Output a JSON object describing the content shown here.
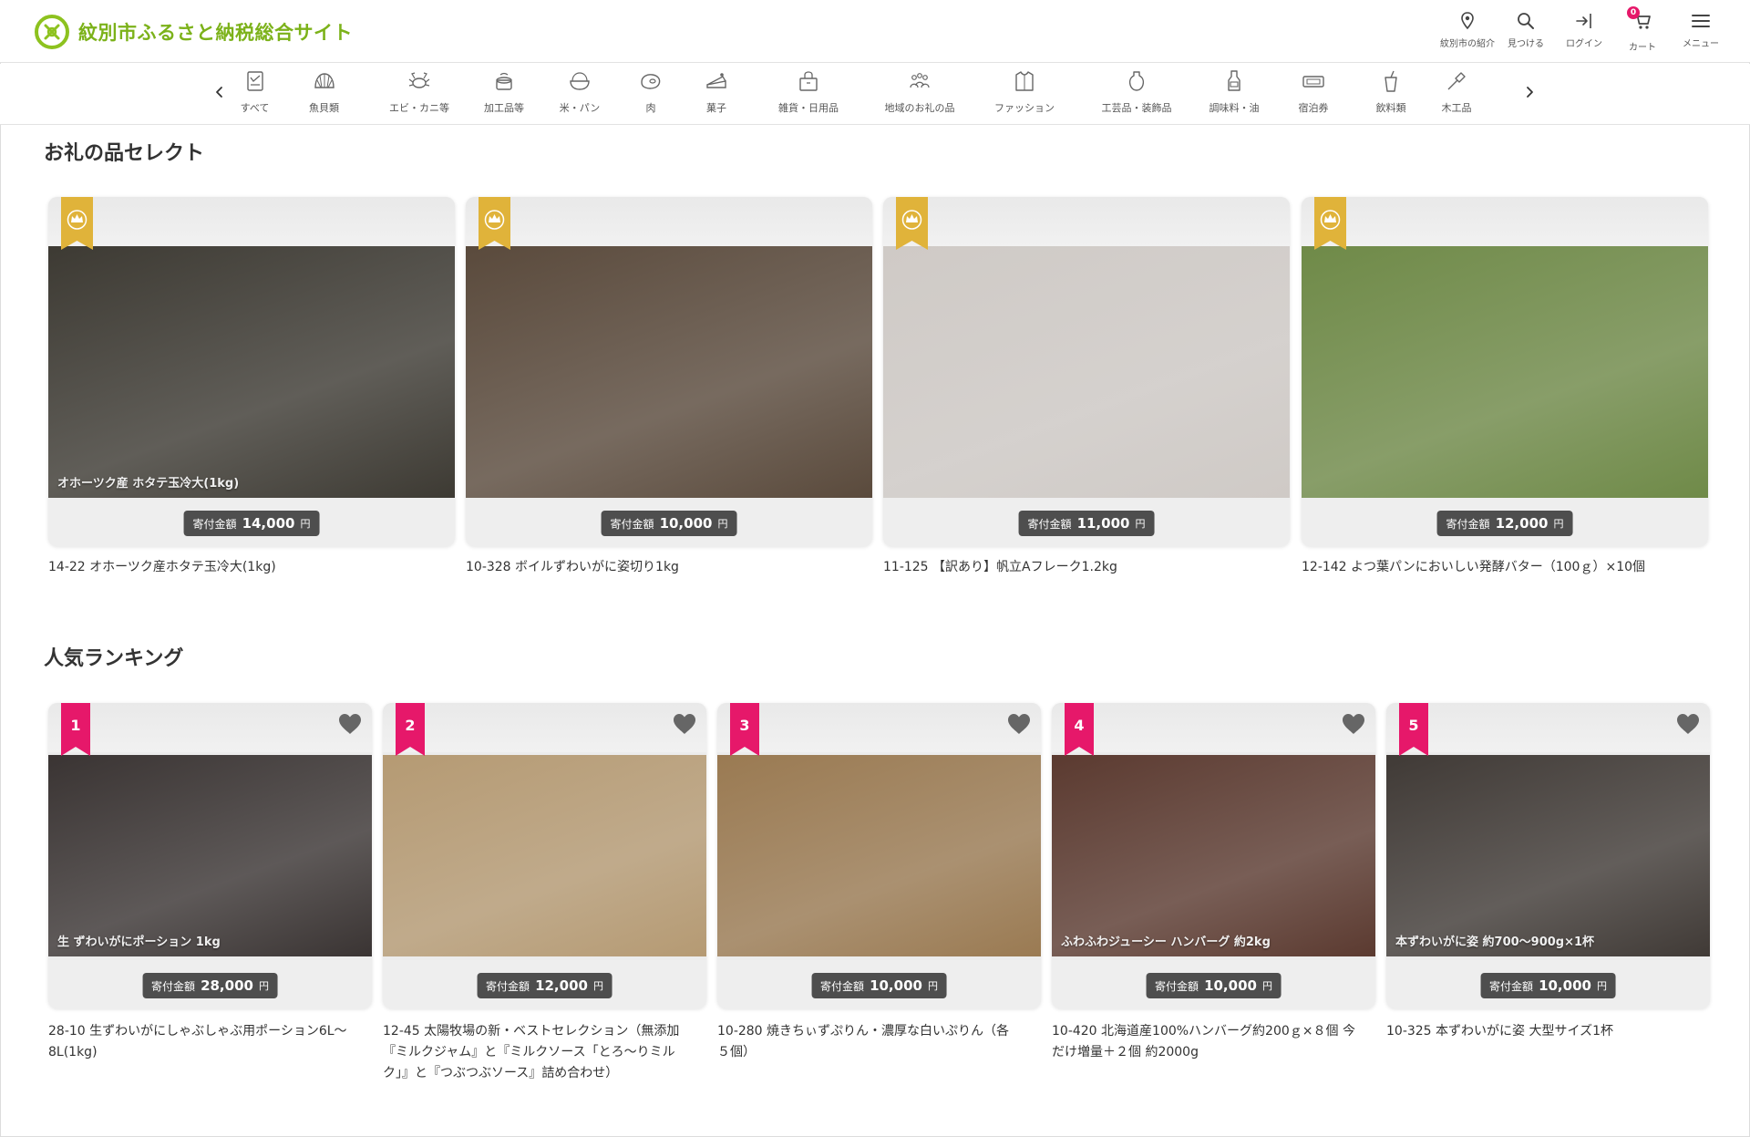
{
  "site": {
    "title": "紋別市ふるさと納税総合サイト",
    "accent": "#7cb21a",
    "ribbon_gold": "#e0b33a",
    "ribbon_pink": "#e6186a"
  },
  "header_nav": [
    {
      "label": "紋別市の紹介",
      "icon": "map-pin-icon"
    },
    {
      "label": "見つける",
      "icon": "search-icon"
    },
    {
      "label": "ログイン",
      "icon": "login-icon"
    },
    {
      "label": "カート",
      "icon": "cart-icon",
      "badge": "0"
    },
    {
      "label": "メニュー",
      "icon": "menu-icon"
    }
  ],
  "categories": [
    {
      "label": "すべて",
      "icon": "all-icon"
    },
    {
      "label": "魚貝類",
      "icon": "shell-icon"
    },
    {
      "label": "エビ・カニ等",
      "icon": "crab-icon"
    },
    {
      "label": "加工品等",
      "icon": "processed-food-icon"
    },
    {
      "label": "米・パン",
      "icon": "rice-icon"
    },
    {
      "label": "肉",
      "icon": "meat-icon"
    },
    {
      "label": "菓子",
      "icon": "cake-icon"
    },
    {
      "label": "雑貨・日用品",
      "icon": "goods-icon"
    },
    {
      "label": "地域のお礼の品",
      "icon": "community-icon"
    },
    {
      "label": "ファッション",
      "icon": "fashion-icon"
    },
    {
      "label": "工芸品・装飾品",
      "icon": "vase-icon"
    },
    {
      "label": "調味料・油",
      "icon": "seasoning-icon"
    },
    {
      "label": "宿泊券",
      "icon": "ticket-icon"
    },
    {
      "label": "飲料類",
      "icon": "drink-icon"
    },
    {
      "label": "木工品",
      "icon": "woodwork-icon"
    }
  ],
  "select_section": {
    "title": "お礼の品セレクト",
    "items": [
      {
        "title": "14-22 オホーツク産ホタテ玉冷大(1kg)",
        "price_label": "寄付金額",
        "price": "14,000",
        "unit": "円",
        "photo_caption": "オホーツク産 ホタテ玉冷大(1kg)",
        "photo_color": "#3d3a33"
      },
      {
        "title": "10-328 ボイルずわいがに姿切り1kg",
        "price_label": "寄付金額",
        "price": "10,000",
        "unit": "円",
        "photo_caption": "",
        "photo_color": "#5a4a3c"
      },
      {
        "title": "11-125 【訳あり】帆立Aフレーク1.2kg",
        "price_label": "寄付金額",
        "price": "11,000",
        "unit": "円",
        "photo_caption": "",
        "photo_color": "#cfcac6"
      },
      {
        "title": "12-142 よつ葉パンにおいしい発酵バター（100ｇ）×10個",
        "price_label": "寄付金額",
        "price": "12,000",
        "unit": "円",
        "photo_caption": "",
        "photo_color": "#6f8a48"
      }
    ]
  },
  "ranking_section": {
    "title": "人気ランキング",
    "items": [
      {
        "rank": "1",
        "title_lines": [
          "28-10 生ずわいがにしゃぶしゃぶ用ポーション6L〜",
          "8L(1kg)"
        ],
        "price_label": "寄付金額",
        "price": "28,000",
        "unit": "円",
        "photo_caption": "生 ずわいがにポーション 1kg",
        "photo_color": "#3a3433"
      },
      {
        "rank": "2",
        "title_lines": [
          "12-45 太陽牧場の新・ベストセレクション（無添加",
          "『ミルクジャム』と『ミルクソース「とろ〜りミル",
          "ク」』と『つぶつぶソース』詰め合わせ）"
        ],
        "price_label": "寄付金額",
        "price": "12,000",
        "unit": "円",
        "photo_caption": "",
        "photo_color": "#b59a73"
      },
      {
        "rank": "3",
        "title_lines": [
          "10-280 焼きちぃずぷりん・濃厚な白いぷりん（各",
          "５個）"
        ],
        "price_label": "寄付金額",
        "price": "10,000",
        "unit": "円",
        "photo_caption": "",
        "photo_color": "#9a7a52"
      },
      {
        "rank": "4",
        "title_lines": [
          "10-420 北海道産100%ハンバーグ約200ｇ×８個 今",
          "だけ増量＋２個 約2000g"
        ],
        "price_label": "寄付金額",
        "price": "10,000",
        "unit": "円",
        "photo_caption": "ふわふわジューシー ハンバーグ 約2kg",
        "photo_color": "#5b3a30"
      },
      {
        "rank": "5",
        "title_lines": [
          "10-325 本ずわいがに姿 大型サイズ1杯"
        ],
        "price_label": "寄付金額",
        "price": "10,000",
        "unit": "円",
        "photo_caption": "本ずわいがに姿 約700〜900g×1杯",
        "photo_color": "#403a36"
      }
    ]
  }
}
